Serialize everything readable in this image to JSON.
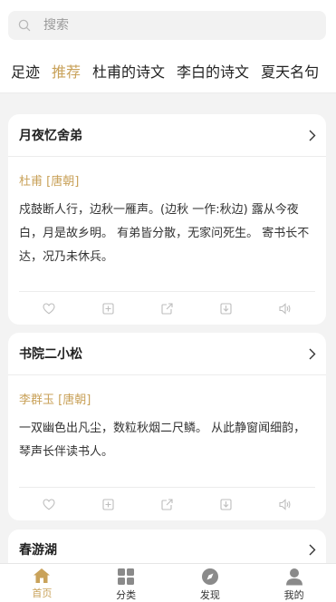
{
  "search": {
    "placeholder": "搜索",
    "icon": "search-icon"
  },
  "tabs": [
    {
      "label": "足迹",
      "active": false
    },
    {
      "label": "推荐",
      "active": true
    },
    {
      "label": "杜甫的诗文",
      "active": false
    },
    {
      "label": "李白的诗文",
      "active": false
    },
    {
      "label": "夏天名句",
      "active": false
    }
  ],
  "cards": [
    {
      "title": "月夜忆舍弟",
      "author": "杜甫 [唐朝]",
      "content": "戍鼓断人行，边秋一雁声。(边秋 一作:秋边) 露从今夜白，月是故乡明。 有弟皆分散，无家问死生。 寄书长不达，况乃未休兵。"
    },
    {
      "title": "书院二小松",
      "author": "李群玉 [唐朝]",
      "content": "一双幽色出凡尘，数粒秋烟二尺鳞。 从此静窗闻细韵，琴声长伴读书人。"
    },
    {
      "title": "春游湖",
      "author": "",
      "content": ""
    }
  ],
  "actions": [
    "heart-icon",
    "add-icon",
    "share-icon",
    "download-icon",
    "speaker-icon"
  ],
  "tabbar": [
    {
      "label": "首页",
      "icon": "home-icon",
      "active": true
    },
    {
      "label": "分类",
      "icon": "grid-icon",
      "active": false
    },
    {
      "label": "发现",
      "icon": "compass-icon",
      "active": false
    },
    {
      "label": "我的",
      "icon": "user-icon",
      "active": false
    }
  ],
  "colors": {
    "accent": "#c9a25a",
    "background": "#f3f3f3",
    "icon_gray": "#bdbdbd"
  }
}
